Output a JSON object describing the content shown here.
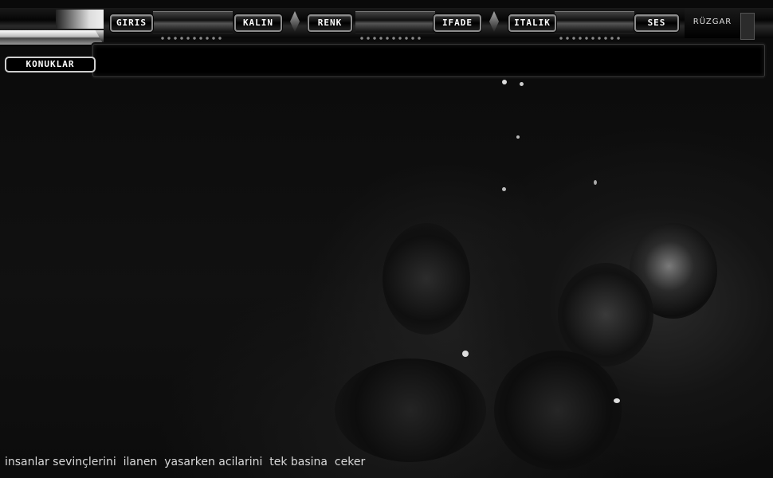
{
  "toolbar": {
    "buttons": [
      {
        "label": "GIRIS"
      },
      {
        "label": "KALIN"
      },
      {
        "label": "RENK"
      },
      {
        "label": "IFADE"
      },
      {
        "label": "ITALIK"
      },
      {
        "label": "SES"
      }
    ],
    "corner_label": "RÜZGAR"
  },
  "sidebar": {
    "guests_label": "KONUKLAR"
  },
  "marquee": {
    "text": "insanlar sevinçlerini  ilanen  yasarken acilarini  tek basina  ceker"
  }
}
